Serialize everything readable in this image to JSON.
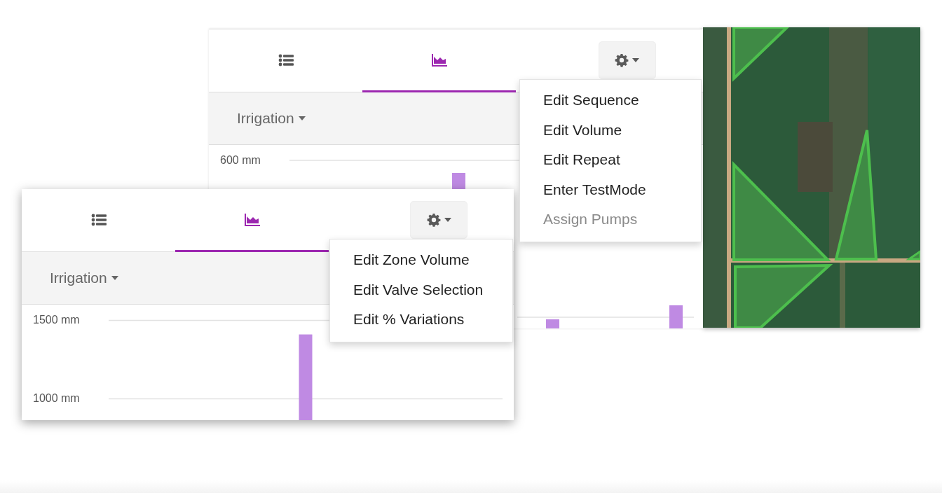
{
  "windows": [
    {
      "tabs": [
        {
          "kind": "list",
          "selected": false
        },
        {
          "kind": "chart",
          "selected": true
        }
      ],
      "settings_button": {
        "expanded": true
      },
      "settings_menu": [
        {
          "label": "Edit Sequence",
          "disabled": false
        },
        {
          "label": "Edit Volume",
          "disabled": false
        },
        {
          "label": "Edit Repeat",
          "disabled": false
        },
        {
          "label": "Enter TestMode",
          "disabled": false
        },
        {
          "label": "Assign Pumps",
          "disabled": true
        }
      ],
      "filter": {
        "label": "Irrigation"
      },
      "chart": {
        "tick_label": "600 mm"
      }
    },
    {
      "tabs": [
        {
          "kind": "list",
          "selected": false
        },
        {
          "kind": "chart",
          "selected": true
        }
      ],
      "settings_button": {
        "expanded": true
      },
      "settings_menu": [
        {
          "label": "Edit Zone Volume",
          "disabled": false
        },
        {
          "label": "Edit Valve Selection",
          "disabled": false
        },
        {
          "label": "Edit % Variations",
          "disabled": false
        }
      ],
      "filter": {
        "label": "Irrigation"
      },
      "chart": {
        "chart_data": {
          "type": "bar",
          "series": [
            {
              "color": "#bf8ae3",
              "values": [
                1410
              ]
            }
          ],
          "ylim": [
            850,
            1500
          ],
          "yticks": [
            {
              "value": 1000,
              "label": "1000 mm"
            },
            {
              "value": 1500,
              "label": "1500 mm"
            }
          ]
        }
      }
    }
  ]
}
